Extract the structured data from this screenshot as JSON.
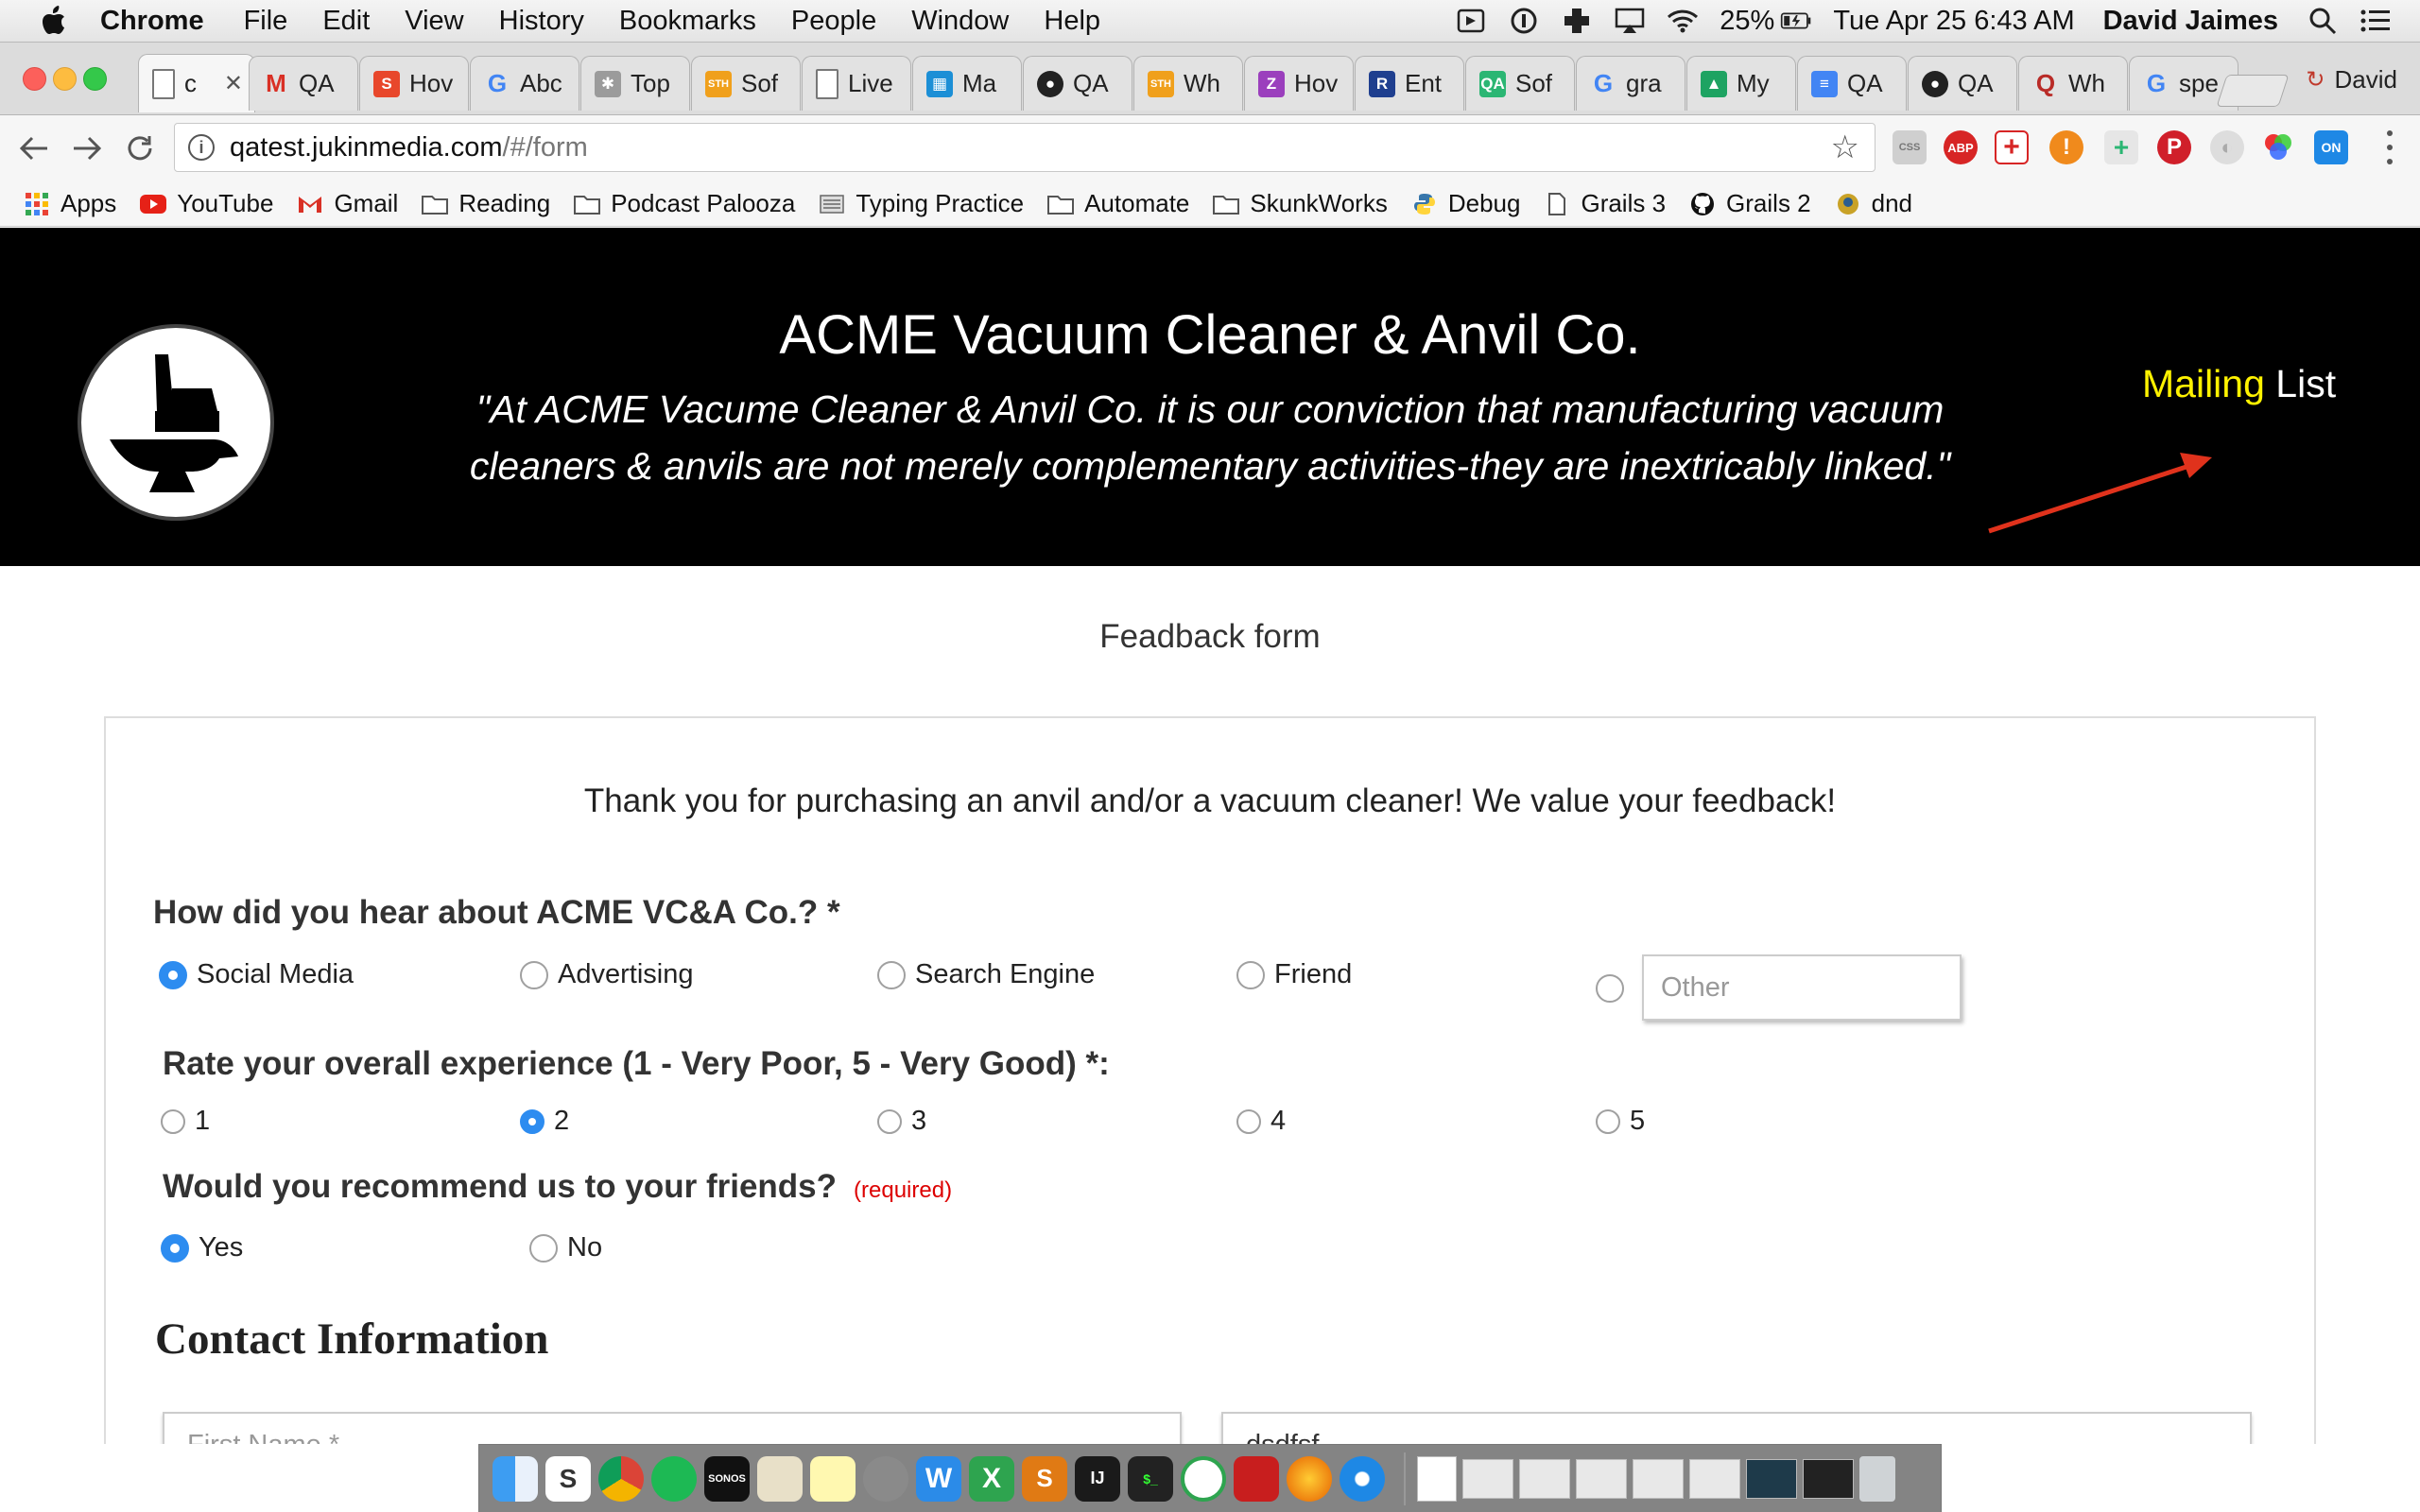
{
  "menubar": {
    "app_name": "Chrome",
    "items": [
      "File",
      "Edit",
      "View",
      "History",
      "Bookmarks",
      "People",
      "Window",
      "Help"
    ],
    "battery": "25%",
    "clock": "Tue Apr 25  6:43 AM",
    "user": "David Jaimes"
  },
  "tabs": [
    {
      "label": "c",
      "icon": "document-icon",
      "color": "#ffffff"
    },
    {
      "label": "QA",
      "icon": "gmail-icon",
      "color": "#d93025"
    },
    {
      "label": "Hov",
      "icon": "s-icon",
      "color": "#e8472b"
    },
    {
      "label": "Abc",
      "icon": "google-icon",
      "color": "#4285f4"
    },
    {
      "label": "Top",
      "icon": "pinwheel-icon",
      "color": "#9b9b9b"
    },
    {
      "label": "Sof",
      "icon": "sth-icon",
      "color": "#f0a01c"
    },
    {
      "label": "Live",
      "icon": "document-icon",
      "color": "#ffffff"
    },
    {
      "label": "Ma",
      "icon": "grid-icon",
      "color": "#1c8fd6"
    },
    {
      "label": "QA",
      "icon": "github-icon",
      "color": "#222222"
    },
    {
      "label": "Wh",
      "icon": "sth-icon",
      "color": "#f0a01c"
    },
    {
      "label": "Hov",
      "icon": "z-icon",
      "color": "#9b3fbd"
    },
    {
      "label": "Ent",
      "icon": "r-icon",
      "color": "#1f3f8f"
    },
    {
      "label": "Sof",
      "icon": "qa-shield-icon",
      "color": "#2bb673"
    },
    {
      "label": "gra",
      "icon": "google-icon",
      "color": "#4285f4"
    },
    {
      "label": "My",
      "icon": "drive-icon",
      "color": "#1ea362"
    },
    {
      "label": "QA",
      "icon": "docs-icon",
      "color": "#4285f4"
    },
    {
      "label": "QA",
      "icon": "github-icon",
      "color": "#222222"
    },
    {
      "label": "Wh",
      "icon": "quora-icon",
      "color": "#b92b27"
    },
    {
      "label": "spe",
      "icon": "google-icon",
      "color": "#4285f4"
    }
  ],
  "profile": "David",
  "address": {
    "host": "qatest.jukinmedia.com",
    "path": "/#/form"
  },
  "bookmarks": [
    {
      "label": "Apps",
      "icon": "apps-grid-icon"
    },
    {
      "label": "YouTube",
      "icon": "youtube-icon"
    },
    {
      "label": "Gmail",
      "icon": "gmail-icon"
    },
    {
      "label": "Reading",
      "icon": "folder-icon"
    },
    {
      "label": "Podcast Palooza",
      "icon": "folder-icon"
    },
    {
      "label": "Typing Practice",
      "icon": "keyboard-icon"
    },
    {
      "label": "Automate",
      "icon": "folder-icon"
    },
    {
      "label": "SkunkWorks",
      "icon": "folder-icon"
    },
    {
      "label": "Debug",
      "icon": "python-icon"
    },
    {
      "label": "Grails 3",
      "icon": "document-icon"
    },
    {
      "label": "Grails 2",
      "icon": "github-icon"
    },
    {
      "label": "dnd",
      "icon": "dnd-icon"
    }
  ],
  "site": {
    "title": "ACME Vacuum Cleaner & Anvil Co.",
    "tagline": "\"At ACME Vacume Cleaner & Anvil Co. it is our conviction that manufacturing vacuum cleaners & anvils are not merely complementary activities-they are inextricably linked.\"",
    "mailing_word1": "Mailing",
    "mailing_word2": "List",
    "mailing_colors": {
      "word1": "#fff200",
      "word2": "#ffffff"
    },
    "arrow_color": "#e0321c"
  },
  "form": {
    "heading": "Feadback form",
    "thanks": "Thank you for purchasing an anvil and/or a vacuum cleaner! We value your feedback!",
    "q1": {
      "label": "How did you hear about ACME VC&A Co.? *",
      "options": [
        "Social Media",
        "Advertising",
        "Search Engine",
        "Friend"
      ],
      "selected": "Social Media",
      "other_placeholder": "Other"
    },
    "q2": {
      "label": "Rate your overall experience (1 - Very Poor, 5 - Very Good) *:",
      "options": [
        "1",
        "2",
        "3",
        "4",
        "5"
      ],
      "selected": "2"
    },
    "q3": {
      "label": "Would you recommend us to your friends?",
      "required_note": "(required)",
      "options": [
        "Yes",
        "No"
      ],
      "selected": "Yes"
    },
    "contact": {
      "title": "Contact Information",
      "first_name_placeholder": "First Name *",
      "last_name_value": "dsdfsf"
    }
  },
  "accent_color": "#2d8cf0"
}
